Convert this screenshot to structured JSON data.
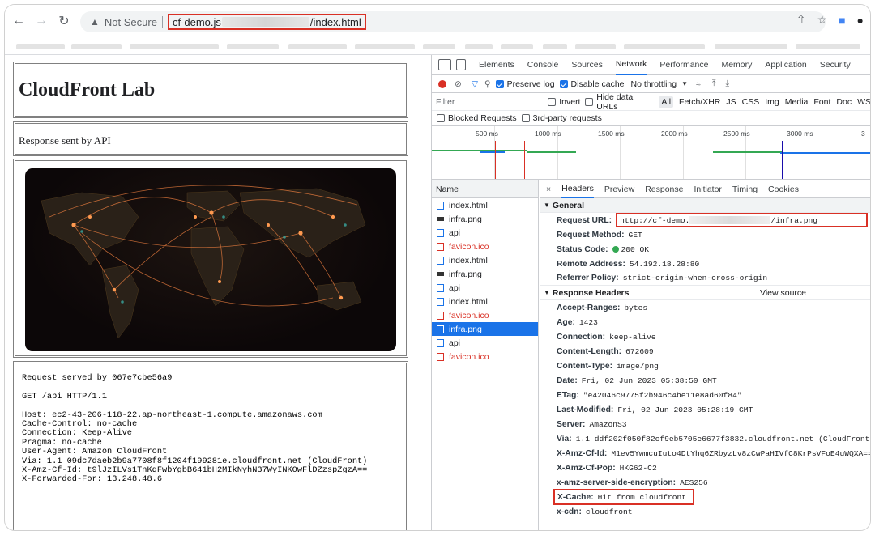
{
  "browser": {
    "not_secure": "Not Secure",
    "url_start": "cf-demo.js",
    "url_end": "/index.html"
  },
  "page": {
    "heading": "CloudFront Lab",
    "response_note": "Response sent by API",
    "request_dump": "Request served by 067e7cbe56a9\n\nGET /api HTTP/1.1\n\nHost: ec2-43-206-118-22.ap-northeast-1.compute.amazonaws.com\nCache-Control: no-cache\nConnection: Keep-Alive\nPragma: no-cache\nUser-Agent: Amazon CloudFront\nVia: 1.1 09dc7daeb2b9a7708f8f1204f199281e.cloudfront.net (CloudFront)\nX-Amz-Cf-Id: t9lJzILVs1TnKqFwbYgbB641bH2MIkNyhN37WyINKOwFlDZzspZgzA==\nX-Forwarded-For: 13.248.48.6"
  },
  "devtools": {
    "tabs": [
      "Elements",
      "Console",
      "Sources",
      "Network",
      "Performance",
      "Memory",
      "Application",
      "Security"
    ],
    "preserve_log": "Preserve log",
    "disable_cache": "Disable cache",
    "throttling": "No throttling",
    "filter_placeholder": "Filter",
    "invert": "Invert",
    "hide_data_urls": "Hide data URLs",
    "type_filters": [
      "All",
      "Fetch/XHR",
      "JS",
      "CSS",
      "Img",
      "Media",
      "Font",
      "Doc",
      "WS"
    ],
    "blocked_requests": "Blocked Requests",
    "third_party": "3rd-party requests",
    "timeline_ticks": [
      "500 ms",
      "1000 ms",
      "1500 ms",
      "2000 ms",
      "2500 ms",
      "3000 ms",
      "3"
    ],
    "name_header": "Name",
    "requests": [
      {
        "name": "index.html",
        "type": "doc"
      },
      {
        "name": "infra.png",
        "type": "img"
      },
      {
        "name": "api",
        "type": "doc"
      },
      {
        "name": "favicon.ico",
        "type": "err"
      },
      {
        "name": "index.html",
        "type": "doc"
      },
      {
        "name": "infra.png",
        "type": "img"
      },
      {
        "name": "api",
        "type": "doc"
      },
      {
        "name": "index.html",
        "type": "doc"
      },
      {
        "name": "favicon.ico",
        "type": "err"
      },
      {
        "name": "infra.png",
        "type": "sel"
      },
      {
        "name": "api",
        "type": "doc"
      },
      {
        "name": "favicon.ico",
        "type": "err"
      }
    ],
    "detail_tabs": [
      "Headers",
      "Preview",
      "Response",
      "Initiator",
      "Timing",
      "Cookies"
    ],
    "general_title": "General",
    "request_url_label": "Request URL:",
    "request_url_start": "http://cf-demo.",
    "request_url_end": "/infra.png",
    "general": [
      {
        "k": "Request Method:",
        "v": "GET"
      },
      {
        "k": "Status Code:",
        "v": "200 OK"
      },
      {
        "k": "Remote Address:",
        "v": "54.192.18.28:80"
      },
      {
        "k": "Referrer Policy:",
        "v": "strict-origin-when-cross-origin"
      }
    ],
    "response_headers_title": "Response Headers",
    "view_source": "View source",
    "response_headers": [
      {
        "k": "Accept-Ranges:",
        "v": "bytes"
      },
      {
        "k": "Age:",
        "v": "1423"
      },
      {
        "k": "Connection:",
        "v": "keep-alive"
      },
      {
        "k": "Content-Length:",
        "v": "672609"
      },
      {
        "k": "Content-Type:",
        "v": "image/png"
      },
      {
        "k": "Date:",
        "v": "Fri, 02 Jun 2023 05:38:59 GMT"
      },
      {
        "k": "ETag:",
        "v": "\"e42046c9775f2b946c4be11e8ad60f84\""
      },
      {
        "k": "Last-Modified:",
        "v": "Fri, 02 Jun 2023 05:28:19 GMT"
      },
      {
        "k": "Server:",
        "v": "AmazonS3"
      },
      {
        "k": "Via:",
        "v": "1.1 ddf202f050f82cf9eb5705e6677f3832.cloudfront.net (CloudFront)"
      },
      {
        "k": "X-Amz-Cf-Id:",
        "v": "M1ev5YwmcuIuto4DtYhq6ZRbyzLv8zCwPaHIVfC8KrPsVFoE4uWQXA=="
      },
      {
        "k": "X-Amz-Cf-Pop:",
        "v": "HKG62-C2"
      },
      {
        "k": "x-amz-server-side-encryption:",
        "v": "AES256"
      }
    ],
    "x_cache_label": "X-Cache:",
    "x_cache_value": "Hit from cloudfront",
    "x_cdn_label": "x-cdn:",
    "x_cdn_value": "cloudfront",
    "colors": {
      "accent": "#1a73e8",
      "highlight": "#d93025"
    }
  }
}
